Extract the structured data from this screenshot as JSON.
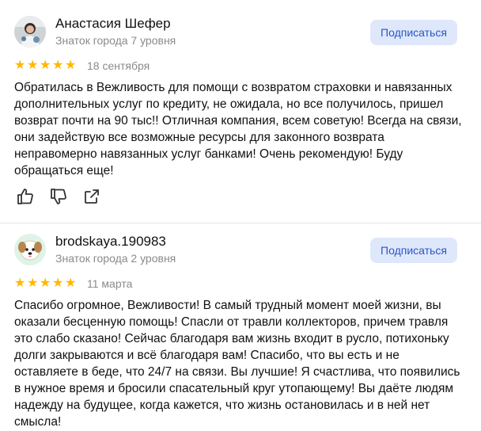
{
  "reviews": [
    {
      "author": "Анастасия Шефер",
      "level": "Знаток города 7 уровня",
      "subscribe_label": "Подписаться",
      "rating": 5,
      "date": "18 сентября",
      "text": "Обратилась в Вежливость для помощи с возвратом страховки и навязанных дополнительных услуг по кредиту, не ожидала, но все получилось, пришел возврат почти на 90 тыс!! Отличная компания, всем советую! Всегда на связи, они задействую все возможные ресурсы для законного возврата неправомерно навязанных услуг банками! Очень рекомендую! Буду обращаться еще!",
      "actions": [
        "like-icon",
        "dislike-icon",
        "share-icon"
      ]
    },
    {
      "author": "brodskaya.190983",
      "level": "Знаток города 2 уровня",
      "subscribe_label": "Подписаться",
      "rating": 5,
      "date": "11 марта",
      "text": "Спасибо огромное, Вежливости! В самый трудный момент моей жизни, вы оказали бесценную помощь! Спасли от травли коллекторов, причем травля это слабо сказано! Сейчас благодаря вам жизнь входит в русло, потихоньку долги закрываются и всё благодаря вам! Спасибо, что вы есть и не оставляете в беде, что 24/7 на связи. Вы лучшие! Я счастлива, что появились в нужное время и бросили спасательный круг утопающему! Вы даёте людям надежду на будущее, когда кажется, что жизнь остановилась и в ней нет смысла!"
    }
  ],
  "colors": {
    "star": "#ffb800",
    "subscribe_bg": "#dfe8fb",
    "subscribe_text": "#2a55c8",
    "muted": "#8a8a8a"
  }
}
